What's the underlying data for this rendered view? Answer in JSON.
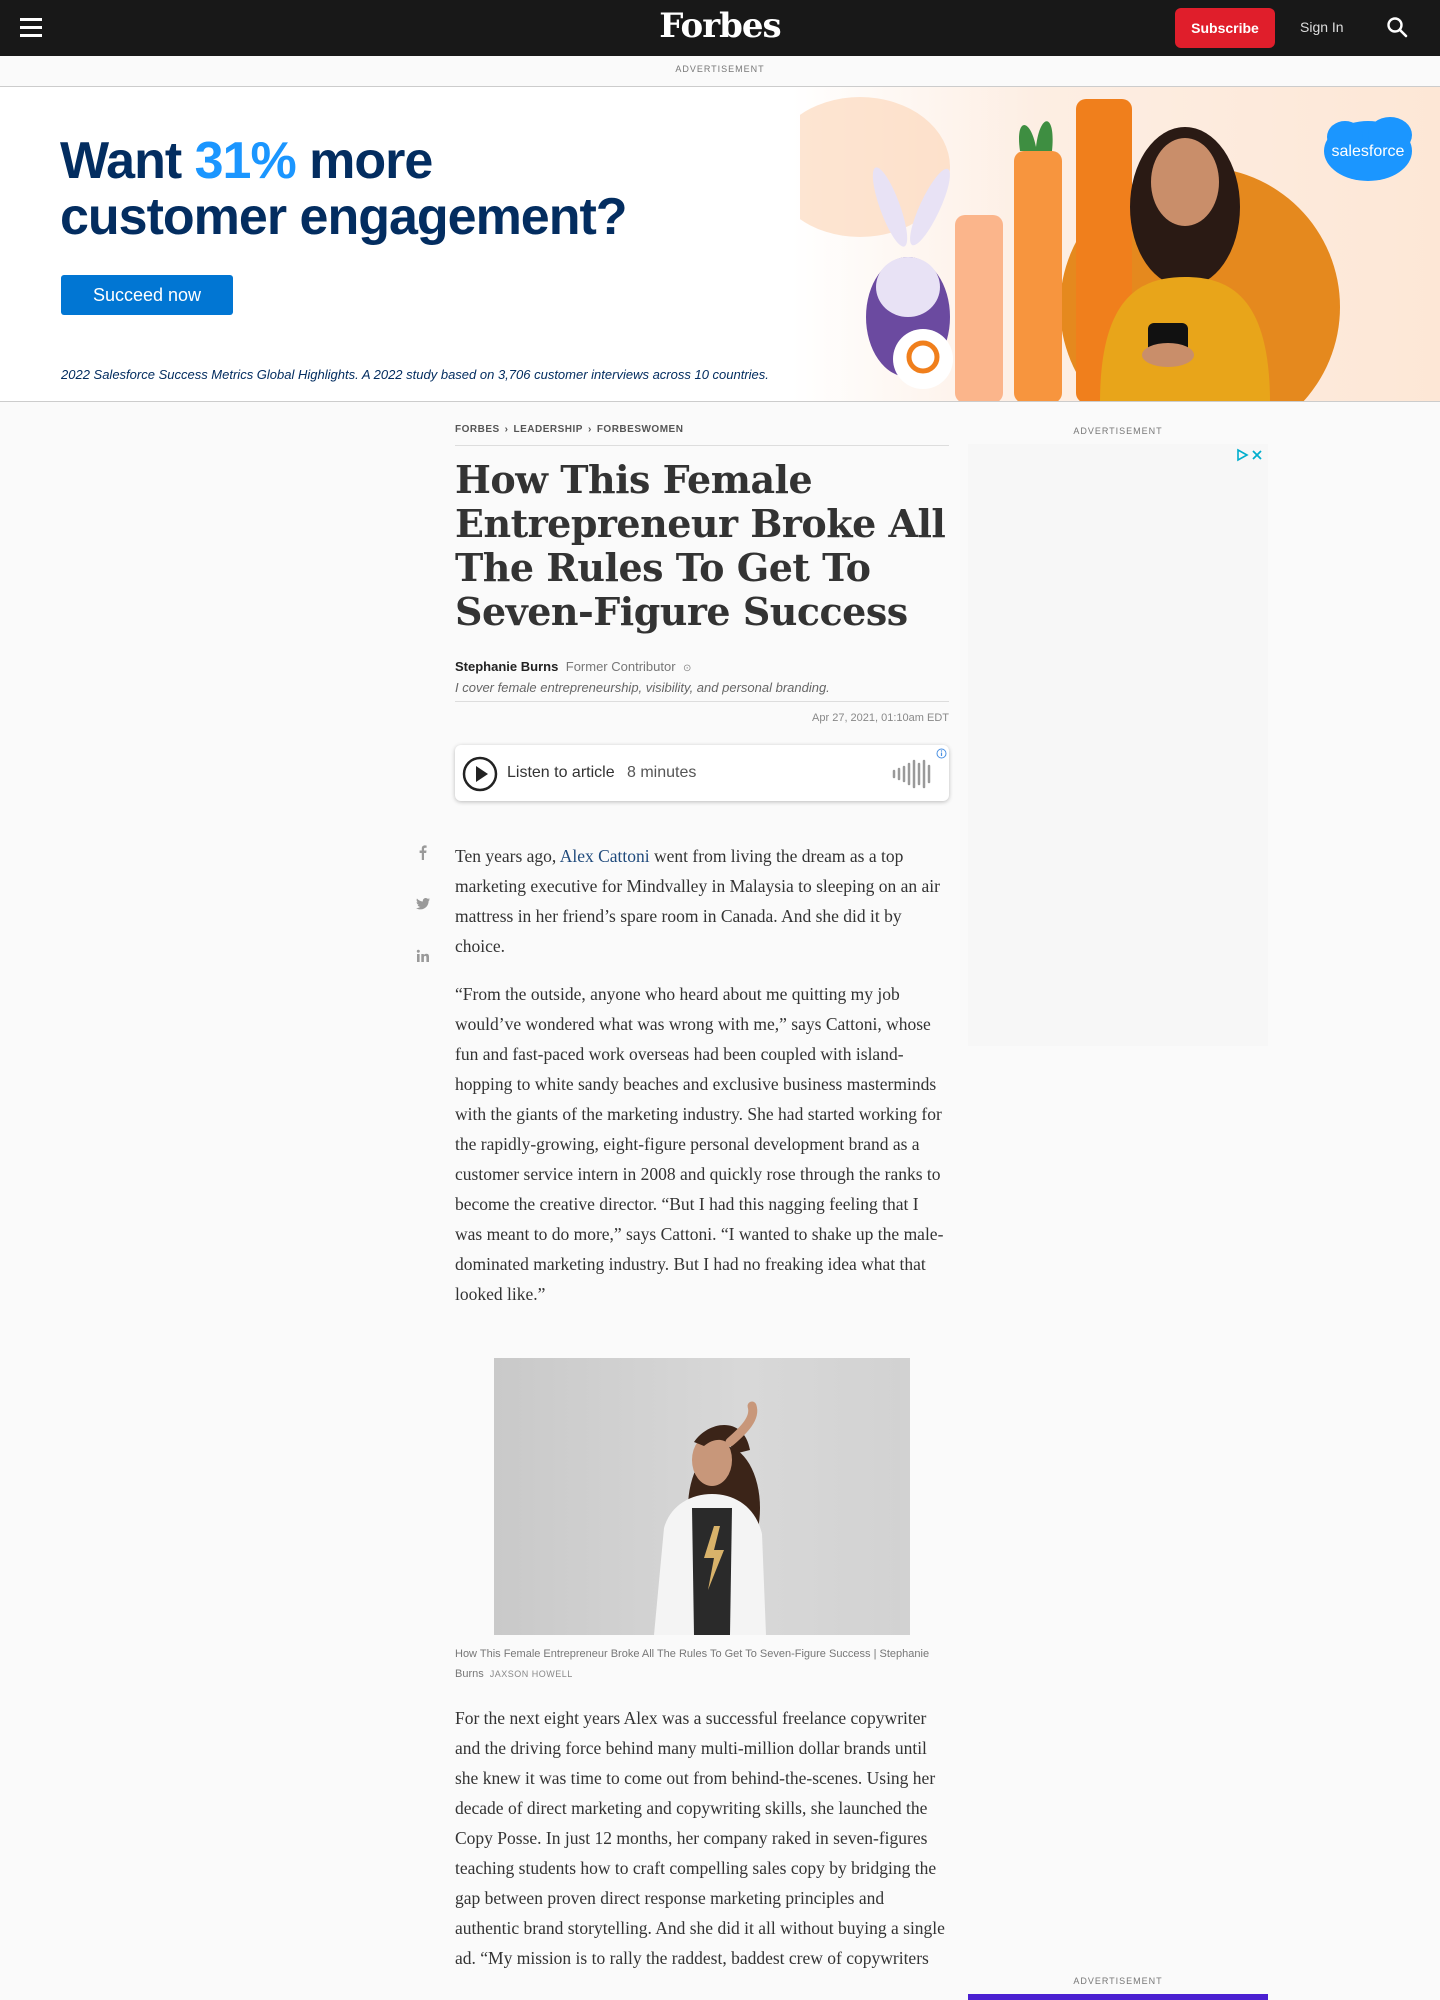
{
  "header": {
    "logo": "Forbes",
    "subscribe_label": "Subscribe",
    "signin_label": "Sign In"
  },
  "ads": {
    "label": "ADVERTISEMENT",
    "banner": {
      "headline_part1": "Want ",
      "headline_accent": "31%",
      "headline_part2": " more",
      "headline_line2": "customer engagement?",
      "cta_label": "Succeed now",
      "footnote": "2022 Salesforce Success Metrics Global Highlights. A 2022 study based on 3,706 customer interviews across 10 countries.",
      "brand": "salesforce"
    }
  },
  "breadcrumb": [
    "FORBES",
    "LEADERSHIP",
    "FORBESWOMEN"
  ],
  "article": {
    "title": "How This Female Entrepreneur Broke All The Rules To Get To Seven-Figure Success",
    "author": "Stephanie Burns",
    "author_role": "Former Contributor",
    "author_bio": "I cover female entrepreneurship, visibility, and personal branding.",
    "date": "Apr 27, 2021, 01:10am EDT",
    "listen_label": "Listen to article",
    "listen_duration": "8 minutes",
    "p1_before": "Ten years ago, ",
    "p1_link": "Alex Cattoni",
    "p1_after": " went from living the dream as a top marketing executive for Mindvalley in Malaysia to sleeping on an air mattress in her friend’s spare room in Canada. And she did it by choice.",
    "p2": "“From the outside, anyone who heard about me quitting my job would’ve wondered what was wrong with me,” says Cattoni, whose fun and fast-paced work overseas had been coupled with island-hopping to white sandy beaches and exclusive business masterminds with the giants of the marketing industry. She had started working for the rapidly-growing, eight-figure personal development brand as a customer service intern in 2008 and quickly rose through the ranks to become the creative director. “But I had this nagging feeling that I was meant to do more,” says Cattoni. “I wanted to shake up the male-dominated marketing industry. But I had no freaking idea what that looked like.”",
    "caption": "How This Female Entrepreneur Broke All The Rules To Get To Seven-Figure Success | Stephanie Burns",
    "photo_credit": "JAXSON HOWELL",
    "p3": "For the next eight years Alex was a successful freelance copywriter and the driving force behind many multi-million dollar brands until she knew it was time to come out from behind-the-scenes. Using her decade of direct marketing and copywriting skills, she launched the Copy Posse. In just 12 months, her company raked in seven-figures teaching students how to craft compelling sales copy by bridging the gap between proven direct response marketing principles and authentic brand storytelling. And she did it all without buying a single ad. “My mission is to rally the raddest, baddest crew of copywriters"
  },
  "icons": [
    "menu-icon",
    "search-icon",
    "play-icon",
    "waveform-icon",
    "info-icon",
    "facebook-icon",
    "twitter-icon",
    "linkedin-icon",
    "adchoices-icon",
    "chevron-right-icon"
  ],
  "colors": {
    "nav_bg": "#181818",
    "subscribe_red": "#e01e2b",
    "salesforce_blue": "#0176d3",
    "link_blue": "#1f4a7c"
  }
}
